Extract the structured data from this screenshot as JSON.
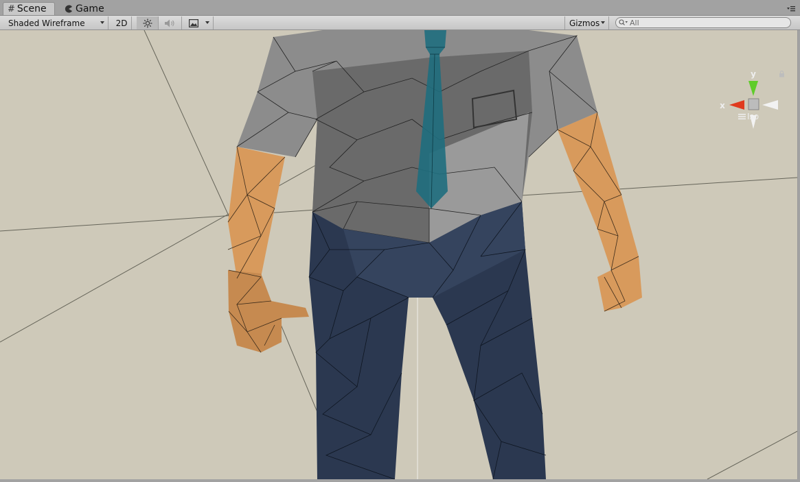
{
  "tabs": [
    {
      "label": "Scene",
      "icon": "grid-icon",
      "active": true
    },
    {
      "label": "Game",
      "icon": "pacman-icon",
      "active": false
    }
  ],
  "toolbar": {
    "draw_mode": "Shaded Wireframe",
    "mode_2d": "2D",
    "gizmos_label": "Gizmos",
    "search_placeholder": "All"
  },
  "gizmo": {
    "y_label": "y",
    "x_label": "x",
    "projection_label": "Iso"
  },
  "colors": {
    "viewport_background": "#cec9b9",
    "shirt": "#8a8a8a",
    "tie": "#1f6e7e",
    "pants": "#2b3850",
    "skin": "#d89a5c",
    "gizmo_x": "#e03a1e",
    "gizmo_y": "#5fcc2a"
  }
}
